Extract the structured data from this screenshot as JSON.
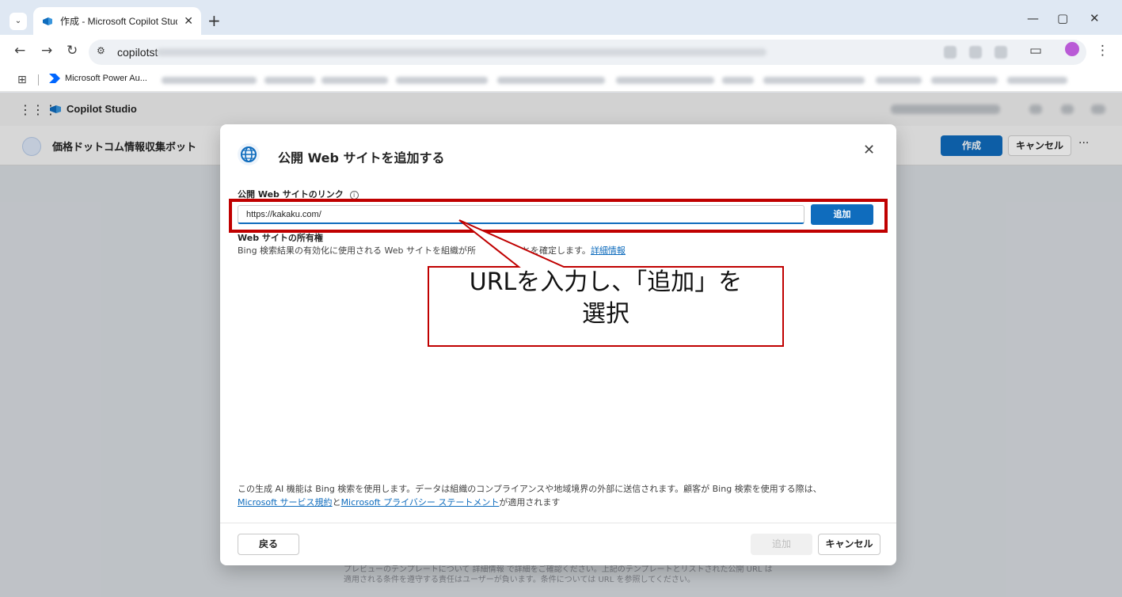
{
  "browser": {
    "tab_title": "作成 - Microsoft Copilot Studio",
    "tab_close": "✕",
    "new_tab": "+",
    "url_prefix": "copilotst",
    "window_min": "—",
    "window_restore": "▢",
    "window_close": "✕",
    "bookmark_first": "Microsoft Power Au..."
  },
  "app": {
    "name": "Copilot Studio",
    "bot_name": "価格ドットコム情報収集ボット",
    "create_label": "作成",
    "cancel_label": "キャンセル",
    "more_label": "···",
    "brand_color": "#0f6cbd"
  },
  "workspace": {
    "line1": "プレビューのテンプレートについて 詳細情報 で詳細をご確認ください。上記のテンプレートとリストされた公開 URL は",
    "line2": "適用される条件を遵守する責任はユーザーが負います。条件については URL を参照してください。"
  },
  "dialog": {
    "title": "公開 Web サイトを追加する",
    "close": "✕",
    "field_label": "公開 Web サイトのリンク",
    "info": "i",
    "url_value": "https://kakaku.com/",
    "add_inline": "追加",
    "ownership_title": "Web サイトの所有権",
    "ownership_desc_pre": "Bing 検索結果の有効化に使用される Web サイトを組織が所",
    "ownership_desc_post": "とを確定します。",
    "ownership_link": "詳細情報",
    "disclaimer_line1": "この生成 AI 機能は Bing 検索を使用します。データは組織のコンプライアンスや地域境界の外部に送信されます。顧客が Bing 検索を使用する際は、",
    "disclaimer_link1": "Microsoft サービス規約",
    "disclaimer_and": "と",
    "disclaimer_link2": "Microsoft プライバシー ステートメント",
    "disclaimer_tail": "が適用されます",
    "back_label": "戻る",
    "add_label": "追加",
    "cancel_label": "キャンセル"
  },
  "annotation": {
    "line1": "URLを入力し、「追加」を",
    "line2": "選択",
    "color": "#c00000"
  }
}
